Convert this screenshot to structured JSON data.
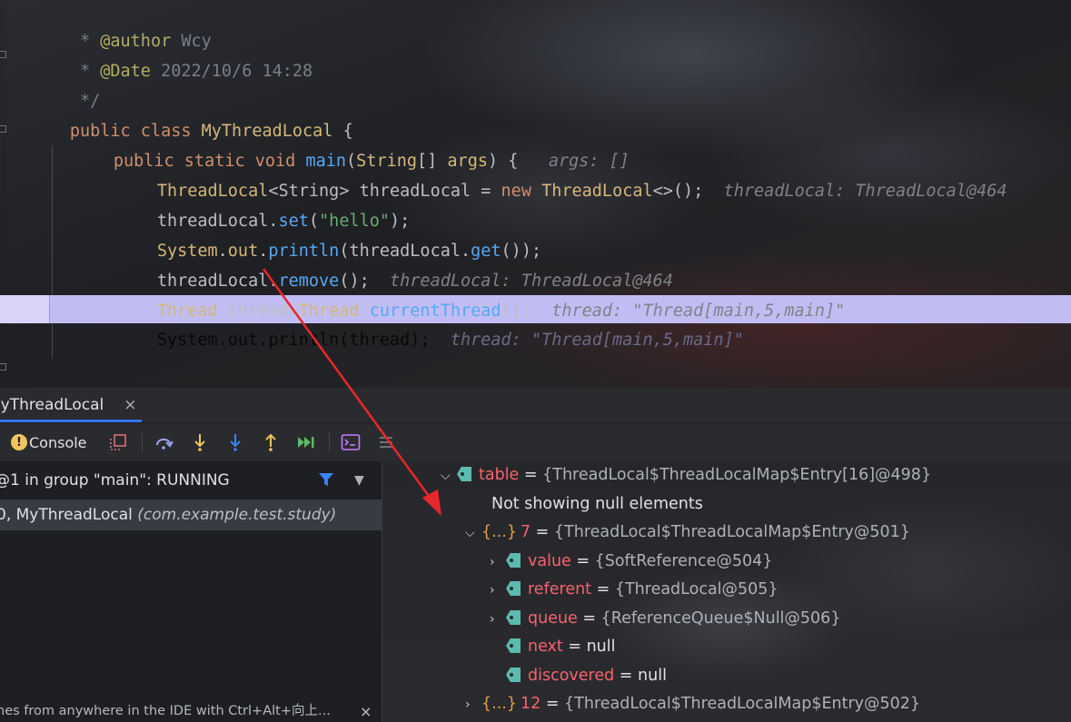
{
  "editor": {
    "lines": [
      {
        "star": " * ",
        "tag": "@author",
        "value": " Wcy"
      },
      {
        "star": " * ",
        "tag": "@Date",
        "value": " 2022/10/6 14:28"
      },
      {
        "end": " */"
      },
      {
        "kw1": "public",
        "kw2": "class",
        "name": "MyThreadLocal",
        "brace": "{"
      },
      {
        "kw1": "public",
        "kw2": "static",
        "kw3": "void",
        "fn": "main",
        "params_type": "String",
        "params_rest": "[] ",
        "param": "args",
        "tail": ") {",
        "hint": "args: []"
      },
      {
        "type": "ThreadLocal",
        "generic": "<String>",
        "var": " threadLocal = ",
        "kw": "new",
        "ctor": "ThreadLocal",
        "tail": "<>();",
        "hint": "threadLocal: ThreadLocal@464"
      },
      {
        "obj": "threadLocal.",
        "fn": "set",
        "open": "(",
        "str": "\"hello\"",
        "close": ");"
      },
      {
        "cls": "System",
        "dot1": ".",
        "field": "out",
        "dot2": ".",
        "fn": "println",
        "open": "(threadLocal.",
        "fn2": "get",
        "close": "());"
      },
      {
        "obj": "threadLocal.",
        "fn": "remove",
        "close": "();",
        "hint": "threadLocal: ThreadLocal@464"
      },
      {
        "type": "Thread",
        "var": " thread=",
        "cls": "Thread",
        "dot": ".",
        "fn": "currentThread",
        "close": "();",
        "hint": "thread: \"Thread[main,5,main]\""
      },
      {
        "code": "System.out.println(thread);",
        "hint": "thread: \"Thread[main,5,main]\""
      },
      {
        "brace": "}"
      }
    ]
  },
  "debug": {
    "tab_label": "MyThreadLocal",
    "tab_close": "×",
    "toolbar": {
      "console_label": "Console",
      "console_badge": "!"
    },
    "frames": {
      "thread_status": "@1 in group \"main\": RUNNING",
      "frame_text": "0, MyThreadLocal ",
      "frame_pkg": "(com.example.test.study)",
      "footer_hint": "nes from anywhere in the IDE with Ctrl+Alt+向上...",
      "footer_close": "×"
    },
    "variables": {
      "table_name": "table",
      "table_value": "{ThreadLocal$ThreadLocalMap$Entry[16]@498}",
      "null_note": "Not showing null elements",
      "entry7_braces": "{...}",
      "entry7_index": "7",
      "entry7_value": "{ThreadLocal$ThreadLocalMap$Entry@501}",
      "fields": [
        {
          "name": "value",
          "value": "{SoftReference@504}",
          "expandable": true
        },
        {
          "name": "referent",
          "value": "{ThreadLocal@505}",
          "expandable": true
        },
        {
          "name": "queue",
          "value": "{ReferenceQueue$Null@506}",
          "expandable": true
        },
        {
          "name": "next",
          "value": "null",
          "expandable": false
        },
        {
          "name": "discovered",
          "value": "null",
          "expandable": false
        }
      ],
      "entry12_braces": "{...}",
      "entry12_index": "12",
      "entry12_value": "{ThreadLocal$ThreadLocalMap$Entry@502}",
      "equals": " = "
    }
  },
  "colors": {
    "highlight_line": "#c1bdf3",
    "arrow": "#e8262b",
    "variable_name": "#f7636d",
    "tag_icon": "#5bbbae"
  }
}
